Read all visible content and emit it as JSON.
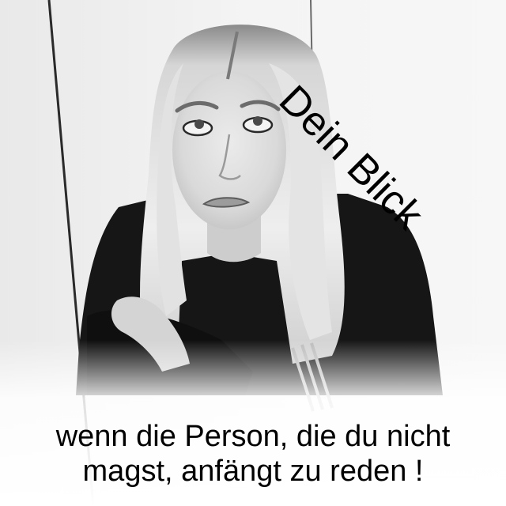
{
  "caption": {
    "top": "Dein Blick",
    "bottom_line1": "wenn die Person, die du nicht",
    "bottom_line2": "magst, anfängt zu reden !"
  },
  "colors": {
    "text": "#000000",
    "background": "#ffffff",
    "photo_tone": "grayscale"
  }
}
